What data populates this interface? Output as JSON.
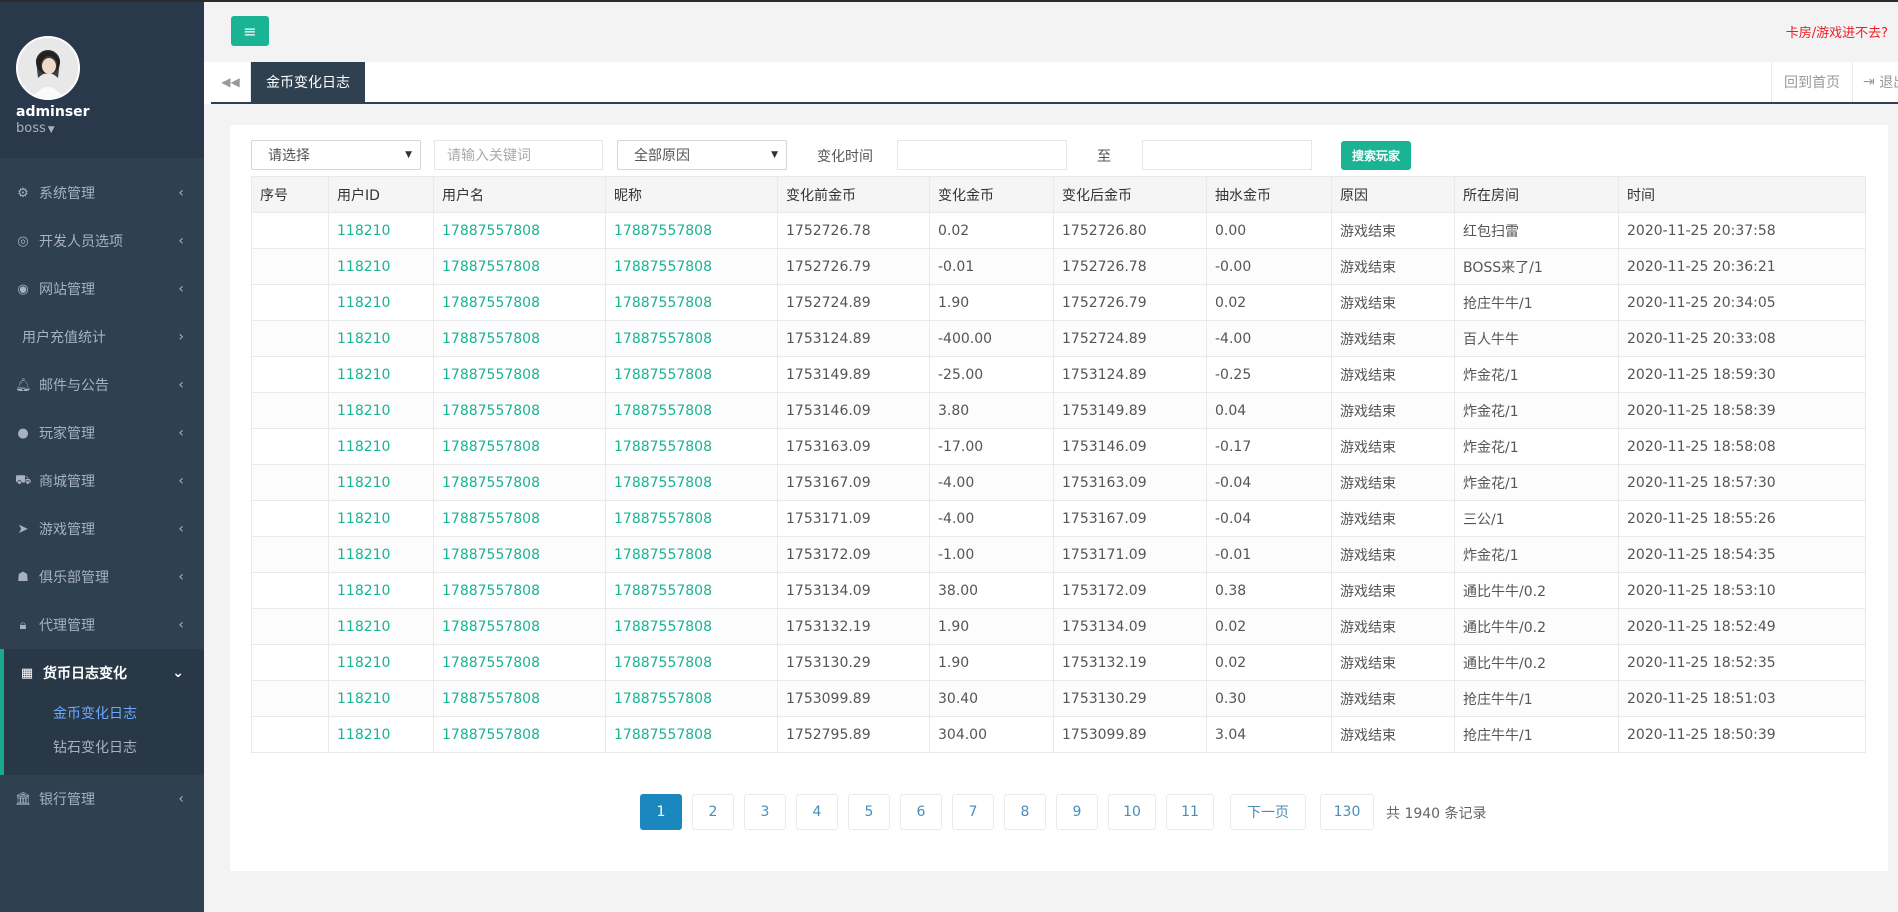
{
  "sidebar": {
    "user_name": "adminser",
    "user_role": "boss",
    "menu": [
      {
        "label": "系统管理",
        "icon": "gears-icon"
      },
      {
        "label": "开发人员选项",
        "icon": "gamepad-icon"
      },
      {
        "label": "网站管理",
        "icon": "globe-icon"
      },
      {
        "label": "用户充值统计",
        "icon": ""
      },
      {
        "label": "邮件与公告",
        "icon": "bell-icon"
      },
      {
        "label": "玩家管理",
        "icon": "user-icon"
      },
      {
        "label": "商城管理",
        "icon": "cart-icon"
      },
      {
        "label": "游戏管理",
        "icon": "rocket-icon"
      },
      {
        "label": "俱乐部管理",
        "icon": "users-icon"
      },
      {
        "label": "代理管理",
        "icon": "lock-icon"
      },
      {
        "label": "货币日志变化",
        "icon": "calendar-icon"
      },
      {
        "label": "银行管理",
        "icon": "bank-icon"
      }
    ],
    "submenu": [
      "金币变化日志",
      "钻石变化日志"
    ]
  },
  "header": {
    "top_link": "卡房/游戏进不去?"
  },
  "tabs": {
    "active": "金币变化日志",
    "home": "回到首页",
    "exit": "退出"
  },
  "filters": {
    "select_label": "请选择",
    "keyword_placeholder": "请输入关键词",
    "reason_select": "全部原因",
    "time_label": "变化时间",
    "to_label": "至",
    "search_button": "搜索玩家"
  },
  "table": {
    "columns": [
      "序号",
      "用户ID",
      "用户名",
      "昵称",
      "变化前金币",
      "变化金币",
      "变化后金币",
      "抽水金币",
      "原因",
      "所在房间",
      "时间"
    ],
    "rows": [
      [
        "",
        "118210",
        "17887557808",
        "17887557808",
        "1752726.78",
        "0.02",
        "1752726.80",
        "0.00",
        "游戏结束",
        "红包扫雷",
        "2020-11-25 20:37:58"
      ],
      [
        "",
        "118210",
        "17887557808",
        "17887557808",
        "1752726.79",
        "-0.01",
        "1752726.78",
        "-0.00",
        "游戏结束",
        "BOSS来了/1",
        "2020-11-25 20:36:21"
      ],
      [
        "",
        "118210",
        "17887557808",
        "17887557808",
        "1752724.89",
        "1.90",
        "1752726.79",
        "0.02",
        "游戏结束",
        "抢庄牛牛/1",
        "2020-11-25 20:34:05"
      ],
      [
        "",
        "118210",
        "17887557808",
        "17887557808",
        "1753124.89",
        "-400.00",
        "1752724.89",
        "-4.00",
        "游戏结束",
        "百人牛牛",
        "2020-11-25 20:33:08"
      ],
      [
        "",
        "118210",
        "17887557808",
        "17887557808",
        "1753149.89",
        "-25.00",
        "1753124.89",
        "-0.25",
        "游戏结束",
        "炸金花/1",
        "2020-11-25 18:59:30"
      ],
      [
        "",
        "118210",
        "17887557808",
        "17887557808",
        "1753146.09",
        "3.80",
        "1753149.89",
        "0.04",
        "游戏结束",
        "炸金花/1",
        "2020-11-25 18:58:39"
      ],
      [
        "",
        "118210",
        "17887557808",
        "17887557808",
        "1753163.09",
        "-17.00",
        "1753146.09",
        "-0.17",
        "游戏结束",
        "炸金花/1",
        "2020-11-25 18:58:08"
      ],
      [
        "",
        "118210",
        "17887557808",
        "17887557808",
        "1753167.09",
        "-4.00",
        "1753163.09",
        "-0.04",
        "游戏结束",
        "炸金花/1",
        "2020-11-25 18:57:30"
      ],
      [
        "",
        "118210",
        "17887557808",
        "17887557808",
        "1753171.09",
        "-4.00",
        "1753167.09",
        "-0.04",
        "游戏结束",
        "三公/1",
        "2020-11-25 18:55:26"
      ],
      [
        "",
        "118210",
        "17887557808",
        "17887557808",
        "1753172.09",
        "-1.00",
        "1753171.09",
        "-0.01",
        "游戏结束",
        "炸金花/1",
        "2020-11-25 18:54:35"
      ],
      [
        "",
        "118210",
        "17887557808",
        "17887557808",
        "1753134.09",
        "38.00",
        "1753172.09",
        "0.38",
        "游戏结束",
        "通比牛牛/0.2",
        "2020-11-25 18:53:10"
      ],
      [
        "",
        "118210",
        "17887557808",
        "17887557808",
        "1753132.19",
        "1.90",
        "1753134.09",
        "0.02",
        "游戏结束",
        "通比牛牛/0.2",
        "2020-11-25 18:52:49"
      ],
      [
        "",
        "118210",
        "17887557808",
        "17887557808",
        "1753130.29",
        "1.90",
        "1753132.19",
        "0.02",
        "游戏结束",
        "通比牛牛/0.2",
        "2020-11-25 18:52:35"
      ],
      [
        "",
        "118210",
        "17887557808",
        "17887557808",
        "1753099.89",
        "30.40",
        "1753130.29",
        "0.30",
        "游戏结束",
        "抢庄牛牛/1",
        "2020-11-25 18:51:03"
      ],
      [
        "",
        "118210",
        "17887557808",
        "17887557808",
        "1752795.89",
        "304.00",
        "1753099.89",
        "3.04",
        "游戏结束",
        "抢庄牛牛/1",
        "2020-11-25 18:50:39"
      ]
    ]
  },
  "pagination": {
    "pages": [
      "1",
      "2",
      "3",
      "4",
      "5",
      "6",
      "7",
      "8",
      "9",
      "10",
      "11"
    ],
    "current": "1",
    "next": "下一页",
    "last": "130",
    "total": "共 1940 条记录"
  },
  "colors": {
    "sidebar_bg": "#2f4050",
    "accent": "#1ab394",
    "link": "#1ab394",
    "page_active": "#1a88bf",
    "warning": "#ed1c24"
  }
}
